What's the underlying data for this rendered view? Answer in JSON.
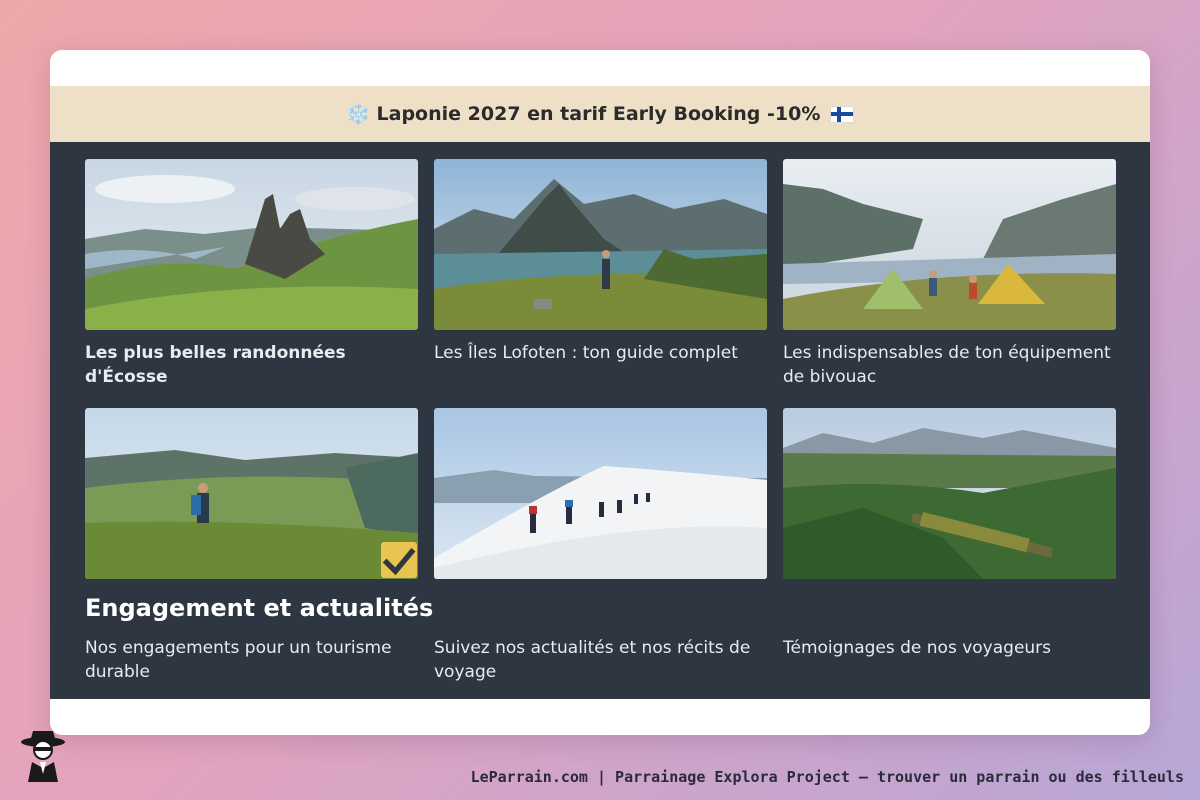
{
  "banner": {
    "snow_icon": "❄️",
    "text": "Laponie 2027 en tarif Early Booking -10%",
    "flag_icon": "finland-flag-icon"
  },
  "articles": [
    {
      "title": "Les plus belles randonnées d'Écosse",
      "image": "scotland-rock-pinnacles-image"
    },
    {
      "title": "Les Îles Lofoten : ton guide complet",
      "image": "lofoten-mountain-hiker-image"
    },
    {
      "title": "Les indispensables de ton équipement de bivouac",
      "image": "fjord-camping-tents-image"
    }
  ],
  "section": {
    "title": "Engagement et actualités",
    "links": [
      {
        "title": "Nos engagements pour un tourisme durable",
        "image": "valley-hiker-image",
        "checked": true
      },
      {
        "title": "Suivez nos actualités et nos récits de voyage",
        "image": "snow-trekkers-image"
      },
      {
        "title": "Témoignages de nos voyageurs",
        "image": "mountain-train-forest-image"
      }
    ]
  },
  "footer": {
    "text": "LeParrain.com | Parrainage Explora Project — trouver un parrain ou des filleuls",
    "logo": "detective-logo-icon"
  },
  "colors": {
    "panel": "#2e3642",
    "banner": "#ede0c6",
    "check": "#eac451"
  }
}
